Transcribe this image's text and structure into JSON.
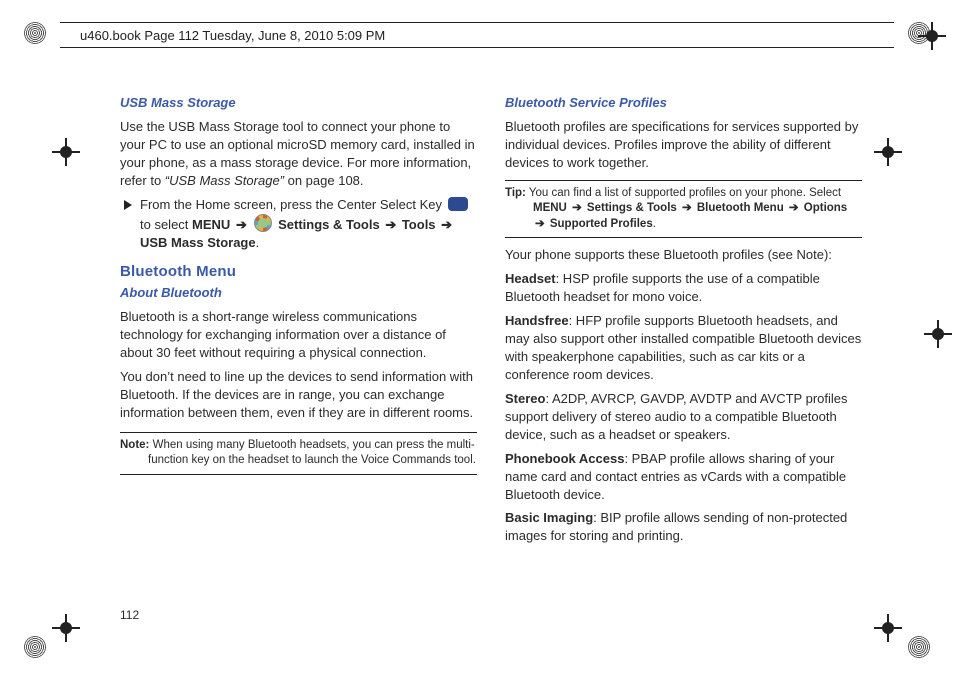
{
  "header": {
    "text": "u460.book  Page 112  Tuesday, June 8, 2010  5:09 PM"
  },
  "page_number": "112",
  "left": {
    "usb_heading": "USB Mass Storage",
    "usb_para_a": "Use the USB Mass Storage tool to connect your phone to your PC to use an optional microSD memory card, installed in your phone, as a mass storage device. For more information, refer to ",
    "usb_para_ital": "“USB Mass Storage”",
    "usb_para_b": "  on page 108.",
    "step_a": "From the Home screen, press the Center Select Key ",
    "step_b": "to select ",
    "menu": "MENU",
    "arrow": "➔",
    "settings_tools": " Settings & Tools ",
    "tools": " Tools ",
    "usb_storage": " USB Mass Storage",
    "period": ".",
    "bt_menu_heading": "Bluetooth Menu",
    "about_bt_heading": "About Bluetooth",
    "bt_p1": "Bluetooth is a short-range wireless communications technology for exchanging information over a distance of about 30 feet without requiring a physical connection.",
    "bt_p2": "You don’t need to line up the devices to send information with Bluetooth. If the devices are in range, you can exchange information between them, even if they are in different rooms.",
    "note_label": "Note:",
    "note_text": " When using many Bluetooth headsets, you can press the multi-function key on the headset to launch the Voice Commands tool."
  },
  "right": {
    "profiles_heading": "Bluetooth Service Profiles",
    "profiles_p1": "Bluetooth profiles are specifications for services supported by individual devices. Profiles improve the ability of different devices to work together.",
    "tip_label": "Tip:",
    "tip_a": " You can find a list of supported profiles on your phone. Select ",
    "tip_menu": "MENU",
    "tip_arrow": "➔",
    "tip_st": "Settings & Tools",
    "tip_btm": "Bluetooth Menu",
    "tip_opt": "Options",
    "tip_sp": "Supported Profiles",
    "supports": "Your phone supports these Bluetooth profiles (see Note):",
    "headset_b": "Headset",
    "headset_t": ": HSP profile supports the use of a compatible Bluetooth headset for mono voice.",
    "handsfree_b": "Handsfree",
    "handsfree_t": ": HFP profile supports Bluetooth headsets, and may also support other installed compatible Bluetooth devices with speakerphone capabilities, such as car kits or a conference room devices.",
    "stereo_b": "Stereo",
    "stereo_t": ": A2DP, AVRCP, GAVDP, AVDTP and AVCTP profiles support delivery of stereo audio to a compatible Bluetooth device, such as a headset or speakers.",
    "pbap_b": "Phonebook Access",
    "pbap_t": ": PBAP profile allows sharing of your name card and contact entries as vCards with a compatible Bluetooth device.",
    "bip_b": "Basic Imaging",
    "bip_t": ": BIP profile allows sending of non-protected images for storing and printing."
  }
}
